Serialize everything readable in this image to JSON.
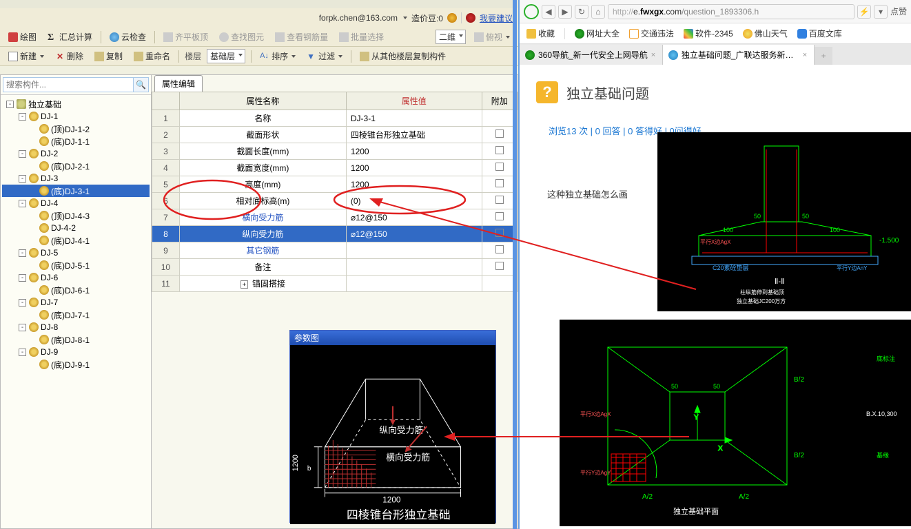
{
  "userbar": {
    "email": "forpk.chen@163.com",
    "credit_label": "造价豆:0",
    "suggest": "我要建议"
  },
  "toolbar1": {
    "draw": "绘图",
    "sigma": "汇总计算",
    "cloud": "云检查",
    "flat": "齐平板顶",
    "find": "查找图元",
    "rebar": "查看钢筋量",
    "batch": "批量选择",
    "view2d": "二维",
    "topview": "俯视"
  },
  "toolbar2": {
    "new": "新建",
    "delete": "删除",
    "copy": "复制",
    "rename": "重命名",
    "floor": "楼层",
    "layer": "基础层",
    "sort": "排序",
    "filter": "过滤",
    "copyfrom": "从其他楼层复制构件"
  },
  "search_placeholder": "搜索构件...",
  "tree": [
    {
      "level": 1,
      "exp": "-",
      "icon": "folder",
      "label": "独立基础"
    },
    {
      "level": 2,
      "exp": "-",
      "icon": "gear",
      "label": "DJ-1"
    },
    {
      "level": 3,
      "icon": "gear",
      "label": "(顶)DJ-1-2"
    },
    {
      "level": 3,
      "icon": "gear",
      "label": "(底)DJ-1-1"
    },
    {
      "level": 2,
      "exp": "-",
      "icon": "gear",
      "label": "DJ-2"
    },
    {
      "level": 3,
      "icon": "gear",
      "label": "(底)DJ-2-1"
    },
    {
      "level": 2,
      "exp": "-",
      "icon": "gear",
      "label": "DJ-3"
    },
    {
      "level": 3,
      "icon": "gear",
      "label": "(底)DJ-3-1",
      "sel": true
    },
    {
      "level": 2,
      "exp": "-",
      "icon": "gear",
      "label": "DJ-4"
    },
    {
      "level": 3,
      "icon": "gear",
      "label": "(顶)DJ-4-3"
    },
    {
      "level": 3,
      "icon": "gear",
      "label": "DJ-4-2"
    },
    {
      "level": 3,
      "icon": "gear",
      "label": "(底)DJ-4-1"
    },
    {
      "level": 2,
      "exp": "-",
      "icon": "gear",
      "label": "DJ-5"
    },
    {
      "level": 3,
      "icon": "gear",
      "label": "(底)DJ-5-1"
    },
    {
      "level": 2,
      "exp": "-",
      "icon": "gear",
      "label": "DJ-6"
    },
    {
      "level": 3,
      "icon": "gear",
      "label": "(底)DJ-6-1"
    },
    {
      "level": 2,
      "exp": "-",
      "icon": "gear",
      "label": "DJ-7"
    },
    {
      "level": 3,
      "icon": "gear",
      "label": "(底)DJ-7-1"
    },
    {
      "level": 2,
      "exp": "-",
      "icon": "gear",
      "label": "DJ-8"
    },
    {
      "level": 3,
      "icon": "gear",
      "label": "(底)DJ-8-1"
    },
    {
      "level": 2,
      "exp": "-",
      "icon": "gear",
      "label": "DJ-9"
    },
    {
      "level": 3,
      "icon": "gear",
      "label": "(底)DJ-9-1"
    }
  ],
  "prop_tab": "属性编辑",
  "prop_headers": {
    "name": "属性名称",
    "value": "属性值",
    "extra": "附加"
  },
  "props": [
    {
      "n": "1",
      "name": "名称",
      "val": "DJ-3-1",
      "ck": false
    },
    {
      "n": "2",
      "name": "截面形状",
      "val": "四棱锥台形独立基础",
      "ck": true
    },
    {
      "n": "3",
      "name": "截面长度(mm)",
      "val": "1200",
      "ck": true
    },
    {
      "n": "4",
      "name": "截面宽度(mm)",
      "val": "1200",
      "ck": true
    },
    {
      "n": "5",
      "name": "高度(mm)",
      "val": "1200",
      "ck": true
    },
    {
      "n": "6",
      "name": "相对底标高(m)",
      "val": "(0)",
      "ck": true
    },
    {
      "n": "7",
      "name": "横向受力筋",
      "val": "⌀12@150",
      "ck": true,
      "blue": true
    },
    {
      "n": "8",
      "name": "纵向受力筋",
      "val": "⌀12@150",
      "ck": true,
      "sel": true
    },
    {
      "n": "9",
      "name": "其它钢筋",
      "val": "",
      "ck": true,
      "blue": true
    },
    {
      "n": "10",
      "name": "备注",
      "val": "",
      "ck": true
    },
    {
      "n": "11",
      "name": "锚固搭接",
      "val": "",
      "ck": false,
      "plus": true
    }
  ],
  "diagram": {
    "title": "参数图",
    "y_label": "纵向受力筋",
    "x_label": "横向受力筋",
    "b": "1200",
    "a": "1200",
    "footer": "四棱锥台形独立基础"
  },
  "browser": {
    "url": "http://e.fwxgx.com/question_1893306.h",
    "more": "点赞",
    "fav": {
      "bm": "收藏",
      "sites": "网址大全",
      "traffic": "交通违法",
      "soft": "软件-2345",
      "weather": "佛山天气",
      "baidu": "百度文库"
    },
    "tabs": [
      {
        "label": "360导航_新一代安全上网导航",
        "active": false
      },
      {
        "label": "独立基础问题_广联达服务新干线",
        "active": true
      }
    ],
    "page": {
      "title": "独立基础问题",
      "stats": "浏览13 次 | 0 回答 | 0 答得好 | 0问得好",
      "question": "这种独立基础怎么画"
    },
    "cad1_labels": {
      "sec": "Ⅱ-Ⅱ",
      "d50a": "50",
      "d50b": "50",
      "d100": "100",
      "neg1500": "-1.500",
      "note": "C20素砼垫层",
      "AgX": "平行X边AgX",
      "AnY": "平行Y边AnY",
      "bottom": "独立基础JC200万方",
      "sub": "柱纵筋伸到基础顶"
    },
    "cad2_labels": {
      "d50a": "50",
      "d50b": "50",
      "a2l": "A/2",
      "a2r": "A/2",
      "b2t": "B/2",
      "b2b": "B/2",
      "notes": "底标注",
      "AgX": "平行X边AgX",
      "AgY": "平行Y边AgY",
      "x": "X",
      "y": "Y",
      "title": "独立基础平面",
      "dim": "B.X.10,300",
      "notes2": "基缘"
    }
  }
}
